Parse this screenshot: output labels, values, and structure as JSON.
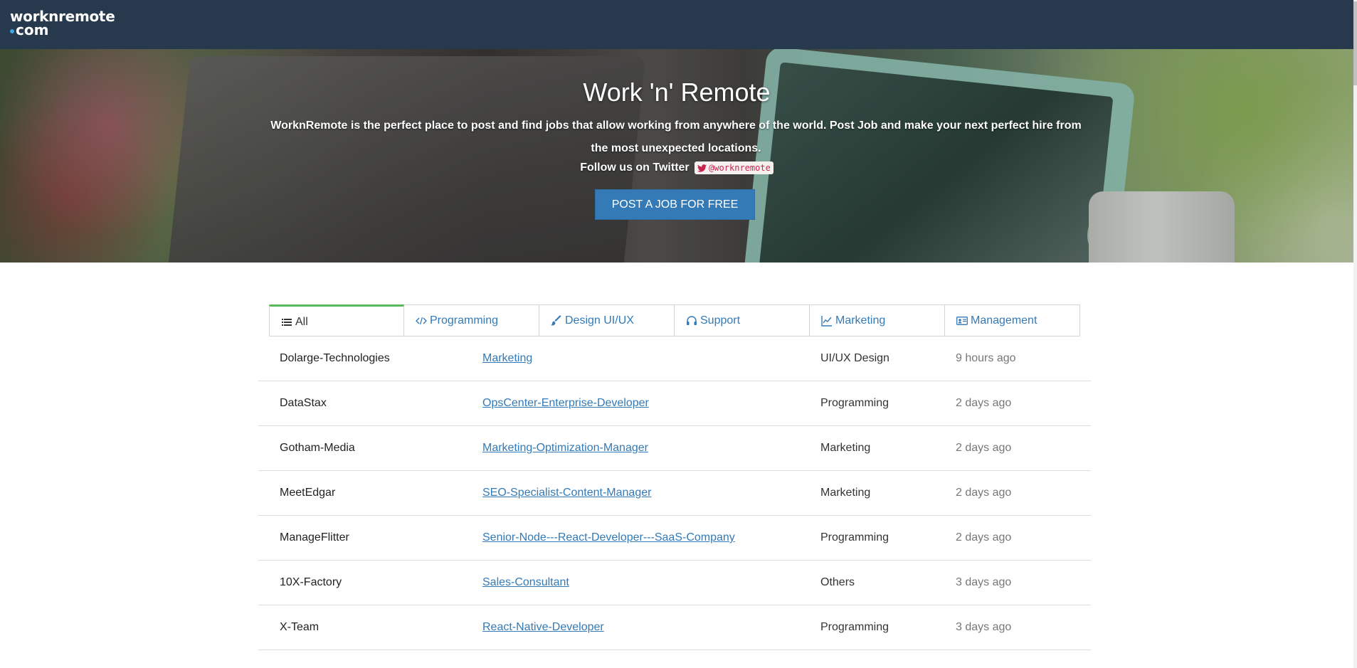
{
  "navbar": {
    "logo_line1": "worknremote",
    "logo_line2": "com"
  },
  "hero": {
    "title": "Work 'n' Remote",
    "description": "WorknRemote is the perfect place to post and find jobs that allow working from anywhere of the world. Post Job and make your next perfect hire from the most unexpected locations.",
    "follow_text": "Follow us on Twitter",
    "twitter_handle": "@worknremote",
    "cta_label": "POST A JOB FOR FREE"
  },
  "tabs": [
    {
      "label": "All",
      "icon": "list-icon",
      "active": true
    },
    {
      "label": "Programming",
      "icon": "code-icon",
      "active": false
    },
    {
      "label": "Design UI/UX",
      "icon": "brush-icon",
      "active": false
    },
    {
      "label": "Support",
      "icon": "headphones-icon",
      "active": false
    },
    {
      "label": "Marketing",
      "icon": "line-chart-icon",
      "active": false
    },
    {
      "label": "Management",
      "icon": "id-card-icon",
      "active": false
    }
  ],
  "jobs": [
    {
      "company": "Dolarge-Technologies",
      "title": "Marketing",
      "category": "UI/UX Design",
      "posted": "9 hours ago"
    },
    {
      "company": "DataStax",
      "title": "OpsCenter-Enterprise-Developer",
      "category": "Programming",
      "posted": "2 days ago"
    },
    {
      "company": "Gotham-Media",
      "title": "Marketing-Optimization-Manager",
      "category": "Marketing",
      "posted": "2 days ago"
    },
    {
      "company": "MeetEdgar",
      "title": "SEO-Specialist-Content-Manager",
      "category": "Marketing",
      "posted": "2 days ago"
    },
    {
      "company": "ManageFlitter",
      "title": "Senior-Node---React-Developer---SaaS-Company",
      "category": "Programming",
      "posted": "2 days ago"
    },
    {
      "company": "10X-Factory",
      "title": "Sales-Consultant",
      "category": "Others",
      "posted": "3 days ago"
    },
    {
      "company": "X-Team",
      "title": "React-Native-Developer",
      "category": "Programming",
      "posted": "3 days ago"
    }
  ],
  "colors": {
    "navbar": "#27394d",
    "primary": "#337ab7",
    "active_tab_border": "#5cb85c",
    "twitter_text": "#c7254e"
  }
}
